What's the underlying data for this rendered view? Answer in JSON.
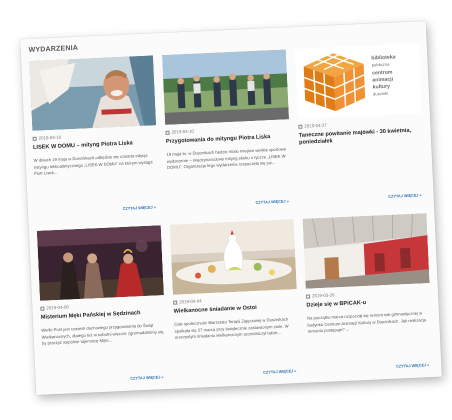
{
  "section_title": "WYDARZENIA",
  "cards": [
    {
      "date": "2019-04-16",
      "title": "LISEK W DOMU – mityng Piotra Liska",
      "excerpt": "W dniach 19 maja w Dusznikach odbędzie się czwarta edycja mityngu lekkoatletycznego „LISEK W DOMU” na którym wystąpi Piotr Lisek...",
      "more": "CZYTAJ WIĘCEJ »"
    },
    {
      "date": "2019-04-10",
      "title": "Przygotowania do mityngu Piotra Liska",
      "excerpt": "19 maja br. w Dusznikach będzie miało miejsce wielkie sportowe wydarzenie – międzynarodowy mityng skoku o tyczce „LISEK W DOMU”. Organizacja tego wydarzenia rozpoczęła się już...",
      "more": "CZYTAJ WIĘCEJ »"
    },
    {
      "date": "2019-04-27",
      "title": "Taneczne powitanie majówki - 30 kwietnia, poniedziałek",
      "excerpt": "",
      "more": "CZYTAJ WIĘCEJ »",
      "logo_text": [
        "biblioteka",
        "publiczna",
        "centrum",
        "animacji",
        "kultury",
        "duszniki"
      ]
    },
    {
      "date": "2019-04-08",
      "title": "Misterium Męki Pańskiej w Sędzinach",
      "excerpt": "Wielki Post jest czasem duchowego przygotowania do Świąt Wielkanocnych, dlatego też w sobotni wieczór zgromadziliśmy się, by przeżyć wspólnie tajemnicę Męki...",
      "more": "CZYTAJ WIĘCEJ »"
    },
    {
      "date": "2019-04-04",
      "title": "Wielkanocne śniadanie w Ostoi",
      "excerpt": "Całe społeczność Warsztatu Terapii Zajęciowej w Dusznikach spotkała się 27 marca przy świątecznie zastawionym stole. W uroczystym śniadaniu wielkanocnym uczestniczył także...",
      "more": "CZYTAJ WIĘCEJ »"
    },
    {
      "date": "2019-03-28",
      "title": "Dzieje się w BPiCAK-u",
      "excerpt": "Na początku marca rozpoczął się remont sali gimnastycznej w budynku Centrum Animacji Kultury w Dusznikach. Jak realizacja remontu postępuje? ...",
      "more": "CZYTAJ WIĘCEJ »"
    }
  ],
  "colors": {
    "accent": "#e98a1e",
    "link": "#2a6fb0"
  }
}
